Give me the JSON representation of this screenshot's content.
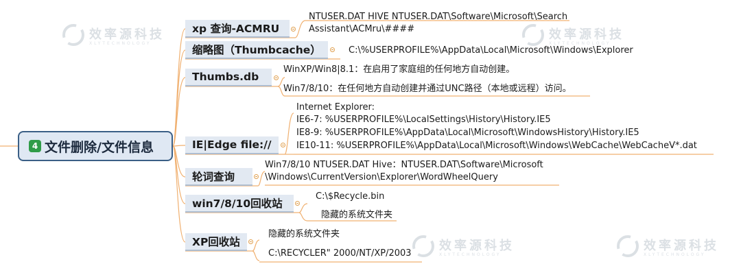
{
  "root": {
    "number": "4",
    "label": "文件删除/文件信息"
  },
  "branches": [
    {
      "id": "acmru",
      "label": "xp 查询-ACMRU",
      "leaves": [
        "NTUSER.DAT HIVE NTUSER.DAT\\Software\\Microsoft\\Search",
        "Assistant\\ACMru\\####"
      ]
    },
    {
      "id": "thumbcache",
      "label": "缩略图（Thumbcache）",
      "leaves": [
        "C:\\%USERPROFILE%\\AppData\\Local\\Microsoft\\Windows\\Explorer"
      ]
    },
    {
      "id": "thumbsdb",
      "label": "Thumbs.db",
      "leaves": [
        "WinXP/Win8|8.1：在启用了家庭组的任何地方自动创建。",
        "Win7/8/10：在任何地方自动创建并通过UNC路径（本地或远程）访问。"
      ]
    },
    {
      "id": "ieedge",
      "label": "IE|Edge file://",
      "leaves": [
        "Internet Explorer:",
        "IE6-7: %USERPROFILE%\\LocalSettings\\History\\History.IE5",
        "IE8-9: %USERPROFILE%\\AppData\\Local\\Microsoft\\WindowsHistory\\History.IE5",
        "IE10-11: %USERPROFILE%\\AppData\\Local\\Microsoft\\Windows\\WebCache\\WebCacheV*.dat"
      ]
    },
    {
      "id": "wordwheel",
      "label": "轮词查询",
      "leaves": [
        "Win7/8/10 NTUSER.DAT Hive：NTUSER.DAT\\Software\\Microsoft",
        "\\Windows\\CurrentVersion\\Explorer\\WordWheelQuery"
      ]
    },
    {
      "id": "win7recycle",
      "label": "win7/8/10回收站",
      "leaves": [
        "C:\\$Recycle.bin",
        "隐藏的系统文件夹"
      ]
    },
    {
      "id": "xprecycle",
      "label": "XP回收站",
      "leaves": [
        "隐藏的系统文件夹",
        "C:\\RECYCLER\" 2000/NT/XP/2003"
      ]
    }
  ],
  "watermark": {
    "text": "效率源科技",
    "sub": "XLYTECHNOLOGY"
  },
  "colors": {
    "branch_fill": "#e2e9f2",
    "root_border": "#3a5f86",
    "connector": "#f0b070",
    "badge": "#2f9c48"
  }
}
